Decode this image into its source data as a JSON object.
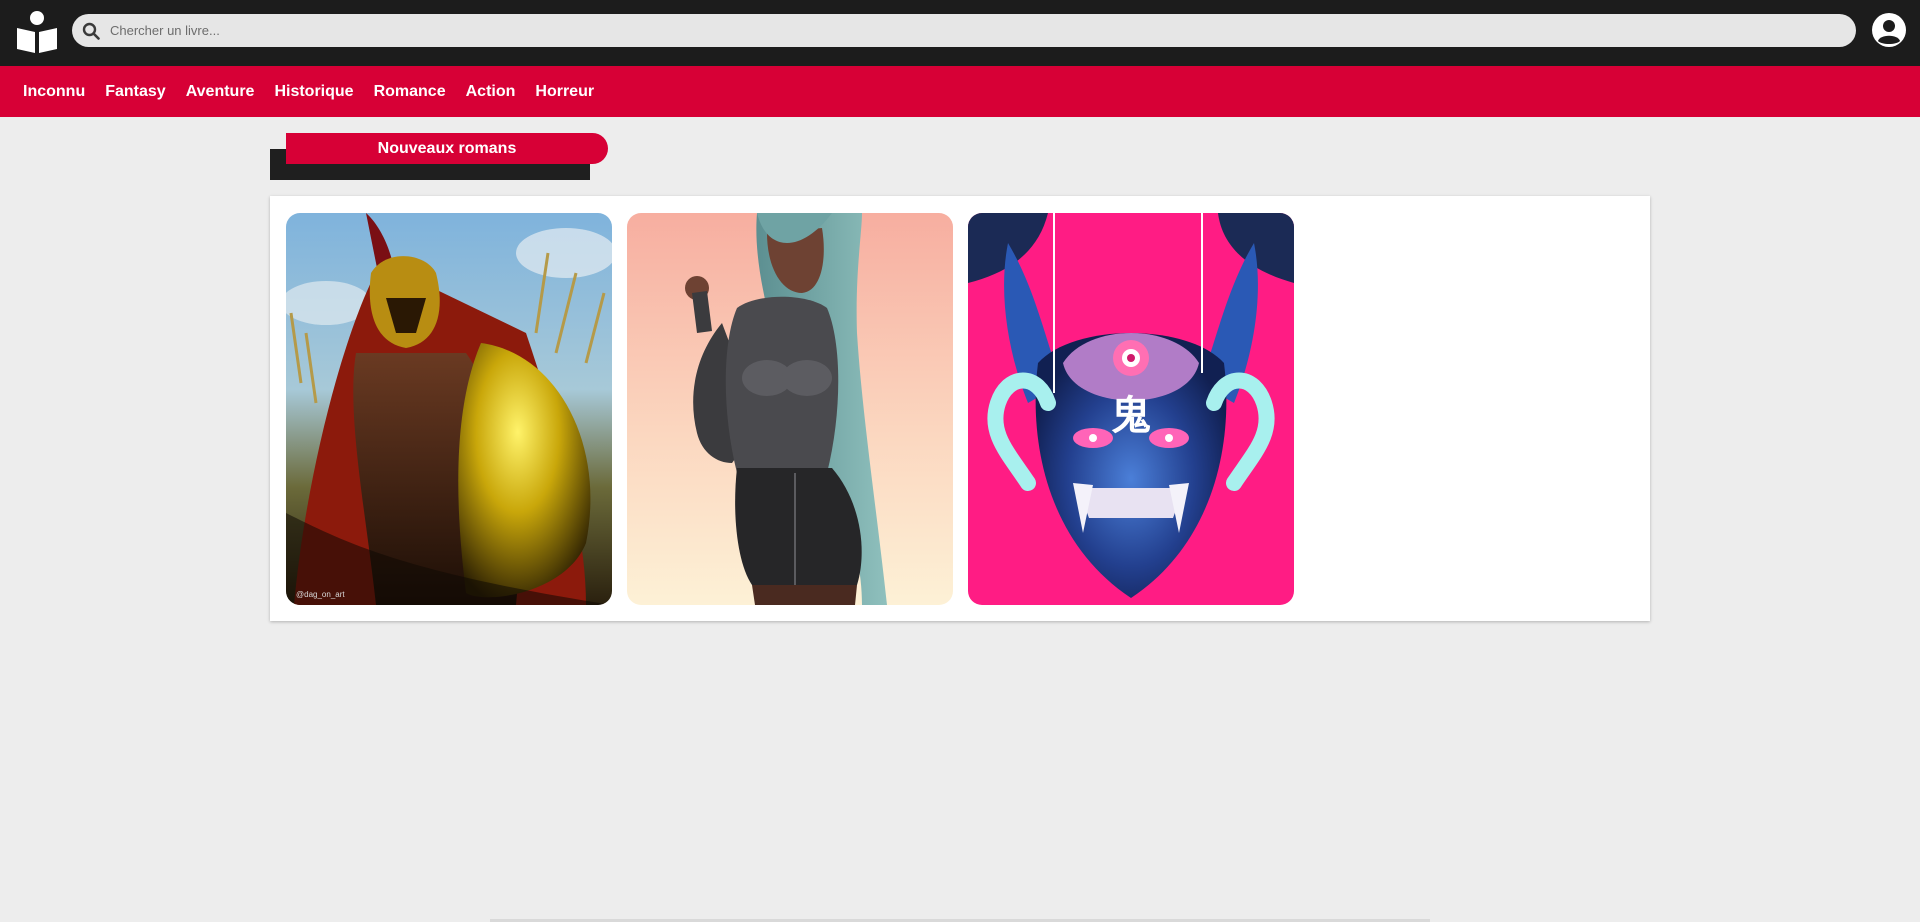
{
  "header": {
    "search": {
      "placeholder": "Chercher un livre...",
      "value": ""
    },
    "icons": {
      "logo": "book-reader-logo",
      "search": "search-icon",
      "account": "user-circle-icon"
    }
  },
  "nav": {
    "items": [
      {
        "label": "Inconnu"
      },
      {
        "label": "Fantasy"
      },
      {
        "label": "Aventure"
      },
      {
        "label": "Historique"
      },
      {
        "label": "Romance"
      },
      {
        "label": "Action"
      },
      {
        "label": "Horreur"
      }
    ]
  },
  "section": {
    "title": "Nouveaux romans"
  },
  "books": [
    {
      "cover": "spartan-warrior-cover",
      "watermark": "@dag_on_art"
    },
    {
      "cover": "teal-haired-woman-cover"
    },
    {
      "cover": "oni-mask-cover",
      "overlay_text": "鬼"
    }
  ],
  "colors": {
    "topbar": "#1c1c1c",
    "accent": "#d70036",
    "background": "#ededed"
  }
}
